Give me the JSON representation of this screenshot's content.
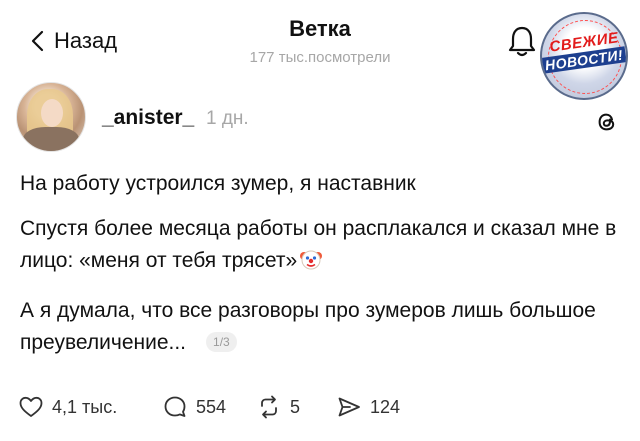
{
  "header": {
    "back_label": "Назад",
    "title": "Ветка",
    "views": "177 тыс.посмотрели"
  },
  "badge": {
    "line1": "СВЕЖИЕ",
    "line2": "НОВОСТИ!"
  },
  "post": {
    "username": "_anister_",
    "time_ago": "1 дн.",
    "paragraphs": [
      "На работу устроился зумер, я наставник",
      "Спустя более месяца работы он расплакался и сказал мне в лицо: «меня от тебя трясет»",
      "А я думала, что все разговоры про зумеров лишь большое преувеличение..."
    ],
    "pager": "1/3",
    "emoji": "clown-face"
  },
  "actions": {
    "likes": "4,1 тыс.",
    "comments": "554",
    "reposts": "5",
    "shares": "124"
  },
  "icons": [
    "chevron-left-icon",
    "bell-icon",
    "threads-icon",
    "heart-icon",
    "comment-icon",
    "repost-icon",
    "send-icon"
  ]
}
